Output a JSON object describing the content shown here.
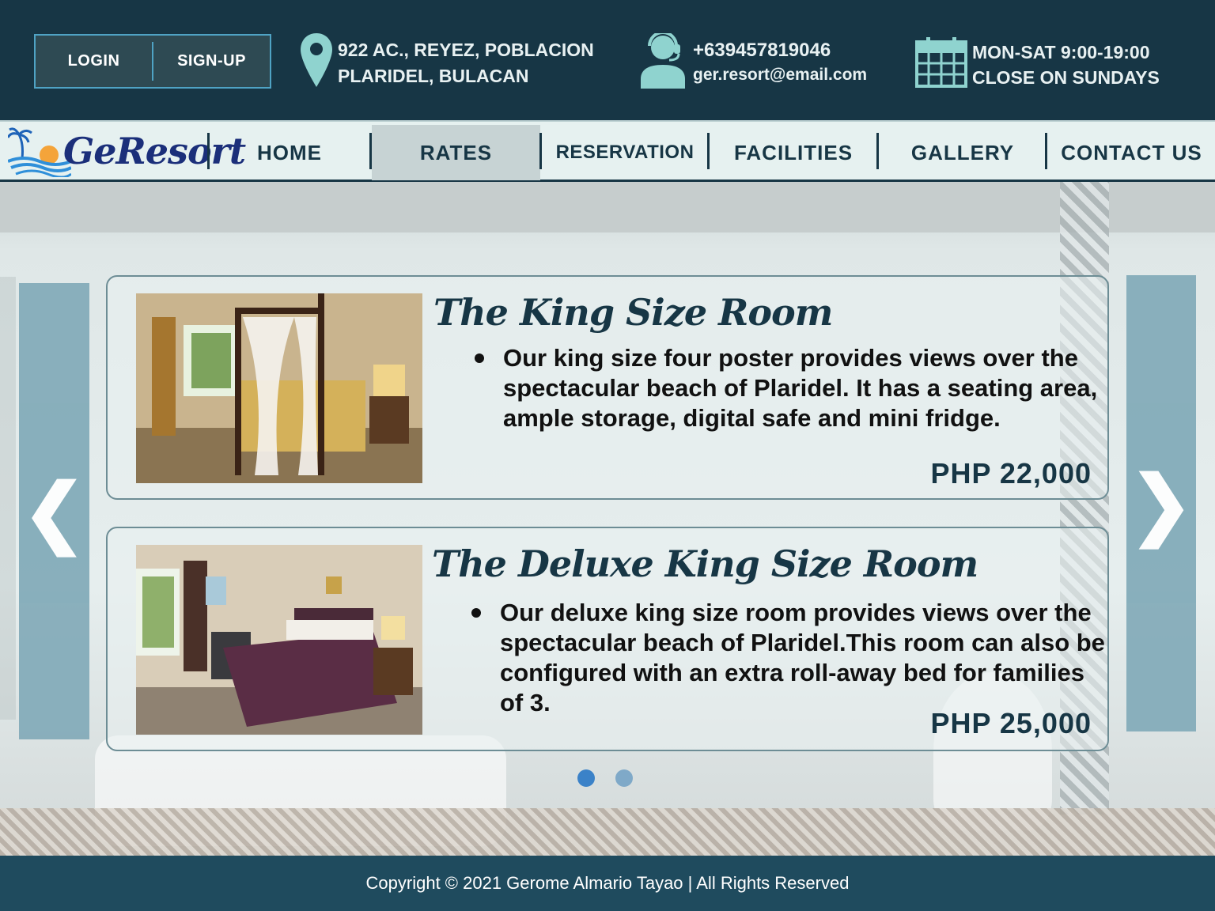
{
  "auth": {
    "login": "LOGIN",
    "signup": "SIGN-UP"
  },
  "contact": {
    "address_line1": "922 AC., REYEZ, POBLACION",
    "address_line2": "PLARIDEL, BULACAN",
    "phone": "+639457819046",
    "email": "ger.resort@email.com",
    "hours_line1": "MON-SAT 9:00-19:00",
    "hours_line2": "CLOSE ON SUNDAYS",
    "icons": [
      "location-pin-icon",
      "support-agent-icon",
      "calendar-icon"
    ]
  },
  "brand": {
    "logo_text": "GeResort"
  },
  "nav": {
    "items": [
      {
        "label": "HOME"
      },
      {
        "label": "RATES"
      },
      {
        "label": "RESERVATION"
      },
      {
        "label": "FACILITIES"
      },
      {
        "label": "GALLERY"
      },
      {
        "label": "CONTACT US"
      }
    ],
    "active": "RATES"
  },
  "carousel": {
    "prev_glyph": "❮",
    "next_glyph": "❯",
    "rooms": [
      {
        "title": "The King Size Room",
        "description": "Our king size four poster provides views over the spectacular beach of Plaridel. It has a seating area, ample storage, digital safe and mini fridge.",
        "price": "PHP 22,000"
      },
      {
        "title": "The Deluxe King Size Room",
        "description": "Our deluxe king size room provides views over the spectacular beach of Plaridel.This room can also be configured with an extra roll-away bed for families of 3.",
        "price": "PHP 25,000"
      }
    ],
    "page_count": 2,
    "active_page": 1
  },
  "footer": {
    "copyright": "Copyright © 2021 Gerome Almario Tayao | All Rights Reserved"
  },
  "colors": {
    "dark": "#173645",
    "accent": "#4fa3c4",
    "nav_bg": "#e6f1f0",
    "footer": "#1f4b5e",
    "dot_active": "#3b82c8",
    "dot_inactive": "#7fa9c8"
  }
}
